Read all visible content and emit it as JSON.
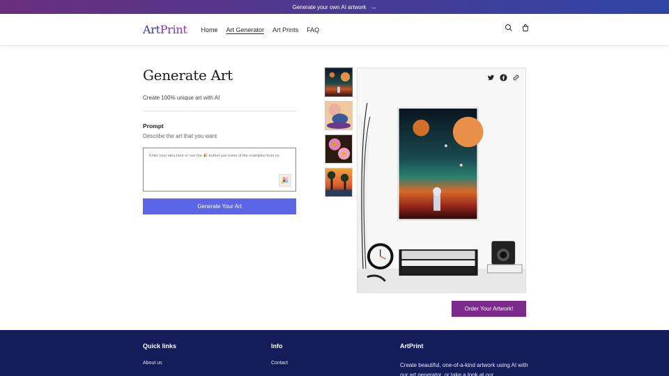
{
  "announcement": {
    "text": "Generate your own AI artwork",
    "arrow_icon": "arrow-right-icon"
  },
  "header": {
    "logo_part1": "Art",
    "logo_part2": "Print",
    "nav": [
      {
        "label": "Home",
        "active": false
      },
      {
        "label": "Art Generator",
        "active": true
      },
      {
        "label": "Art Prints",
        "active": false
      },
      {
        "label": "FAQ",
        "active": false
      }
    ],
    "icons": [
      "search-icon",
      "cart-icon"
    ]
  },
  "generator": {
    "title": "Generate Art",
    "subtitle": "Create 100% unique art with AI",
    "prompt_label": "Prompt",
    "prompt_description": "Describe the art that you want",
    "prompt_placeholder": "Enter your idea here or use the 🎉 button use some of the examples from us.",
    "prompt_value": "",
    "random_button_icon": "🎉",
    "generate_button": "Generate Your Art"
  },
  "gallery": {
    "selected_index": 0,
    "thumbnails": [
      "astronaut-planets",
      "frog-moon",
      "pink-flowers",
      "sunset-trees"
    ],
    "share_icons": [
      "twitter-icon",
      "facebook-icon",
      "link-icon"
    ],
    "order_button": "Order Your Artwork!"
  },
  "footer": {
    "quick_links_title": "Quick links",
    "quick_links": [
      "About us"
    ],
    "info_title": "Info",
    "info_links": [
      "Contact"
    ],
    "brand_title": "ArtPrint",
    "brand_text": "Create beautiful, one-of-a-kind artwork using AI with our art generator, or take a look at our"
  },
  "colors": {
    "generate_button": "#5a66e6",
    "order_button": "#7a2a8a",
    "footer_bg": "#141d5a",
    "announce_gradient": [
      "#6a2f7e",
      "#3046a6"
    ]
  }
}
